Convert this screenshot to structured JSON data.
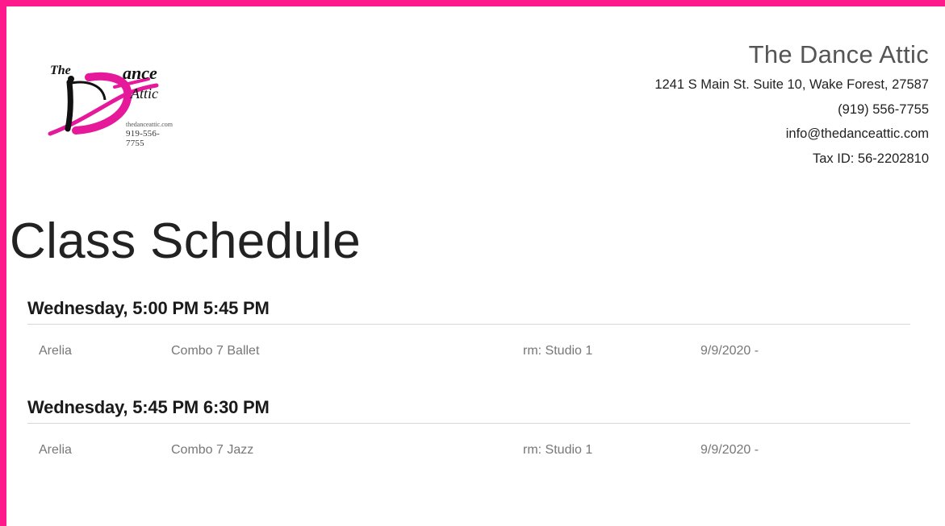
{
  "logo": {
    "the": "The",
    "d": "D",
    "ance": "ance",
    "attic": "Attic",
    "site": "thedanceattic.com",
    "phone": "919-556-7755",
    "colors": {
      "magenta": "#e6199b",
      "black": "#111111"
    }
  },
  "company": {
    "name": "The Dance Attic",
    "address": "1241 S Main St. Suite 10, Wake Forest, 27587",
    "phone": "(919) 556-7755",
    "email": "info@thedanceattic.com",
    "tax_id": "Tax ID: 56-2202810"
  },
  "title": "Class Schedule",
  "sessions": [
    {
      "heading": "Wednesday, 5:00 PM 5:45 PM",
      "teacher": "Arelia",
      "class_name": "Combo 7 Ballet",
      "room": "rm: Studio 1",
      "date": "9/9/2020 -"
    },
    {
      "heading": "Wednesday, 5:45 PM 6:30 PM",
      "teacher": "Arelia",
      "class_name": "Combo 7 Jazz",
      "room": "rm: Studio 1",
      "date": "9/9/2020 -"
    }
  ],
  "colors": {
    "border": "#ff1a8c",
    "divider": "#d8d8d8"
  }
}
